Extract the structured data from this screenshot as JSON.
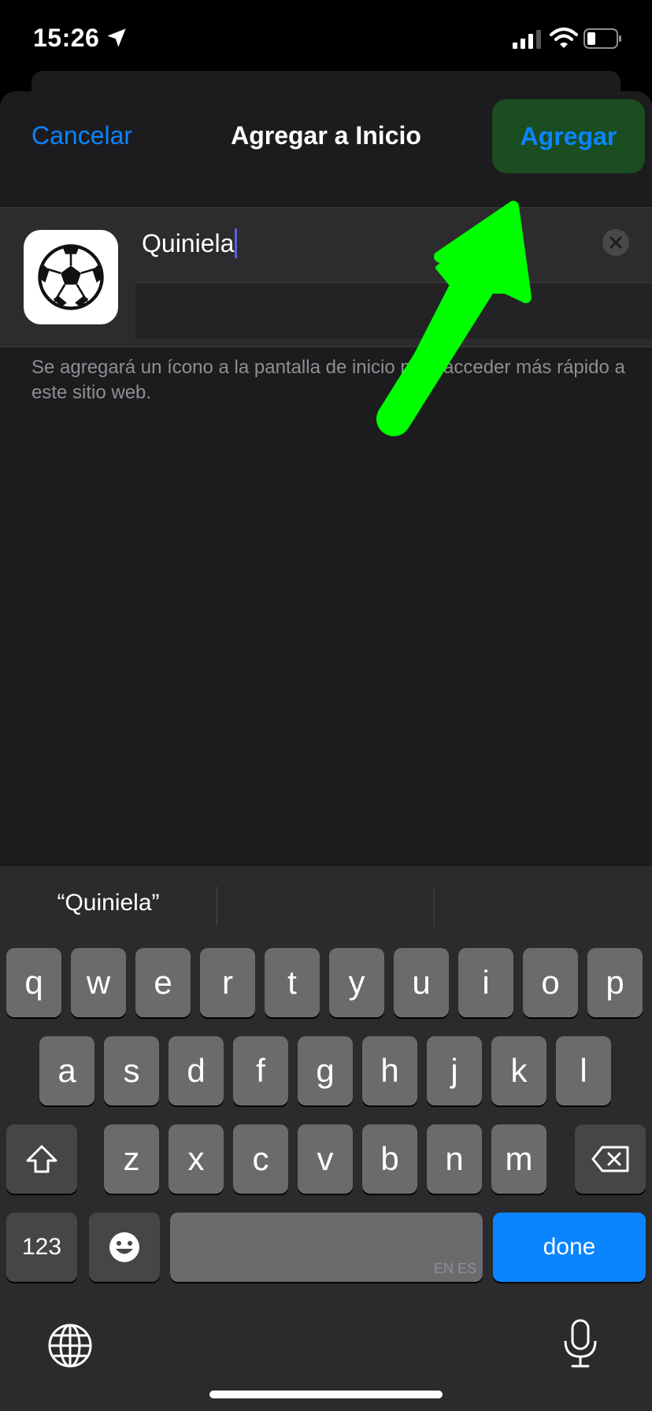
{
  "status_bar": {
    "time": "15:26"
  },
  "sheet": {
    "cancel_label": "Cancelar",
    "title": "Agregar a Inicio",
    "add_label": "Agregar",
    "name_value": "Quiniela",
    "helper_text": "Se agregará un ícono a la pantalla de inicio para acceder más rápido a este sitio web."
  },
  "keyboard": {
    "suggestion": "“Quiniela”",
    "row1": [
      "q",
      "w",
      "e",
      "r",
      "t",
      "y",
      "u",
      "i",
      "o",
      "p"
    ],
    "row2": [
      "a",
      "s",
      "d",
      "f",
      "g",
      "h",
      "j",
      "k",
      "l"
    ],
    "row3": [
      "z",
      "x",
      "c",
      "v",
      "b",
      "n",
      "m"
    ],
    "numbers_label": "123",
    "space_hint": "EN ES",
    "done_label": "done"
  },
  "colors": {
    "accent": "#0a84ff",
    "arrow": "#00ff00",
    "add_highlight": "#1a4d1f"
  }
}
